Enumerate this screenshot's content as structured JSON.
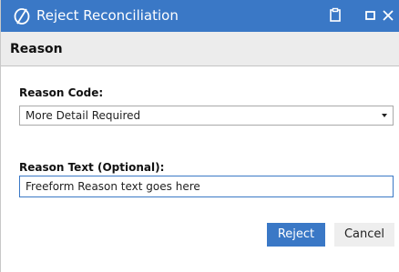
{
  "window": {
    "title": "Reject Reconciliation"
  },
  "header": {
    "title": "Reason"
  },
  "form": {
    "reason_code_label": "Reason Code:",
    "reason_code_value": "More Detail Required",
    "reason_text_label": "Reason Text (Optional):",
    "reason_text_value": "Freeform Reason text goes here"
  },
  "buttons": {
    "reject_label": "Reject",
    "cancel_label": "Cancel"
  },
  "colors": {
    "accent": "#3a78c6",
    "header_bg": "#ececec"
  },
  "icons": {
    "app": "app-logo-icon",
    "restore": "clipboard-icon",
    "maximize": "maximize-icon",
    "close": "close-icon"
  }
}
